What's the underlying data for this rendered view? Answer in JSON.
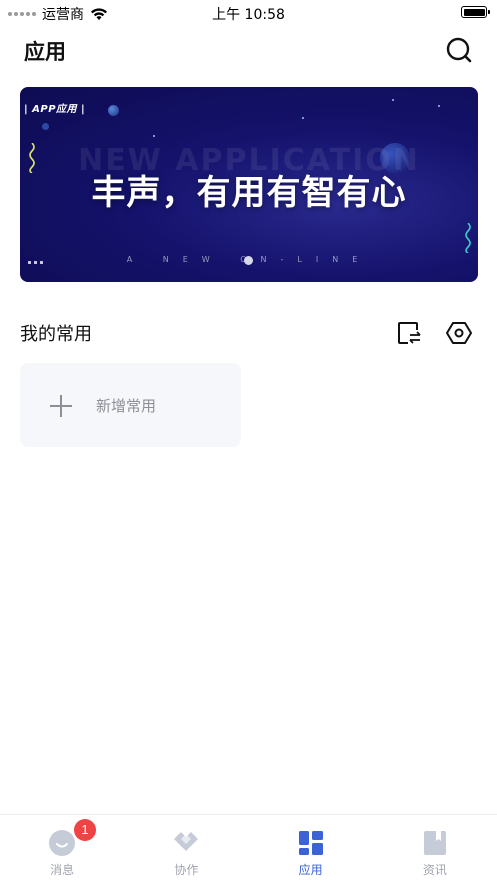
{
  "status_bar": {
    "carrier": "运营商",
    "time": "上午 10:58"
  },
  "header": {
    "title": "应用",
    "search_icon": "search-icon"
  },
  "banner": {
    "tag": "| APP应用 |",
    "ghost_text": "NEW APPLICATION",
    "headline": "丰声，有用有智有心",
    "subline": "A NEW ON-LINE",
    "colors": {
      "background": "#14126b",
      "accent": "#3b5bc6"
    }
  },
  "favorites": {
    "title": "我的常用",
    "switch_icon": "swap-icon",
    "settings_icon": "settings-icon",
    "add_label": "新增常用"
  },
  "tab_bar": {
    "active_color": "#3b63d6",
    "inactive_color": "#a0a4ad",
    "tabs": [
      {
        "label": "消息",
        "icon": "message-icon",
        "badge": "1"
      },
      {
        "label": "协作",
        "icon": "collaboration-icon"
      },
      {
        "label": "应用",
        "icon": "apps-icon",
        "active": true
      },
      {
        "label": "资讯",
        "icon": "news-icon"
      }
    ]
  }
}
